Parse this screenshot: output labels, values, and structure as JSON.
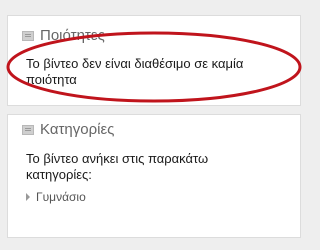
{
  "quality_panel": {
    "title": "Ποιότητες",
    "message": "Το βίντεο δεν είναι διαθέσιμο σε καμία ποιότητα"
  },
  "categories_panel": {
    "title": "Κατηγορίες",
    "message": "Το βίντεο ανήκει στις παρακάτω κατηγορίες:",
    "items": [
      {
        "label": "Γυμνάσιο"
      }
    ]
  },
  "annotation": {
    "color": "#c0141c"
  }
}
